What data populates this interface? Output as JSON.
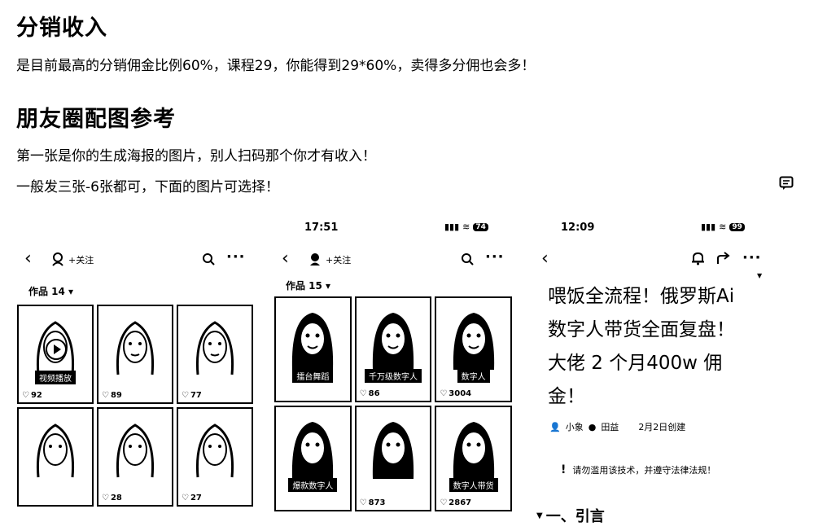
{
  "section_income": {
    "heading": "分销收入",
    "text": "是目前最高的分销佣金比例60%，课程29，你能得到29*60%，卖得多分佣也会多！"
  },
  "section_moments": {
    "heading": "朋友圈配图参考",
    "line1": "第一张是你的生成海报的图片，别人扫码那个你才有收入！",
    "line2": "一般发三张-6张都可，下面的图片可选择！"
  },
  "phone1": {
    "follow": "+关注",
    "works": "作品 14 ▾",
    "cells": [
      {
        "likes": "92",
        "tag": "视频播放"
      },
      {
        "likes": "89",
        "tag": ""
      },
      {
        "likes": "77",
        "tag": ""
      },
      {
        "likes": "",
        "tag": ""
      },
      {
        "likes": "28",
        "tag": ""
      },
      {
        "likes": "27",
        "tag": ""
      }
    ]
  },
  "phone2": {
    "time": "17:51",
    "battery": "74",
    "follow": "+关注",
    "works": "作品 15 ▾",
    "cells": [
      {
        "likes": "",
        "tag": "擂台舞蹈"
      },
      {
        "likes": "86",
        "tag": "千万级数字人"
      },
      {
        "likes": "3004",
        "tag": "数字人"
      },
      {
        "likes": "",
        "tag": "爆款数字人"
      },
      {
        "likes": "873",
        "tag": ""
      },
      {
        "likes": "2867",
        "tag": "数字人带货"
      }
    ]
  },
  "phone3": {
    "time": "12:09",
    "battery": "99",
    "title": "喂饭全流程！俄罗斯Ai 数字人带货全面复盘！大佬 2 个月400w 佣金！",
    "author1": "小象",
    "author2": "田益",
    "date": "2月2日创建",
    "warning": "请勿滥用该技术，并遵守法律法规！",
    "section": "一、引言"
  },
  "icons": {
    "comment": "comment-icon",
    "back": "chevron-left-icon",
    "search": "search-icon",
    "more": "more-icon",
    "bell": "bell-icon",
    "share": "share-icon"
  }
}
